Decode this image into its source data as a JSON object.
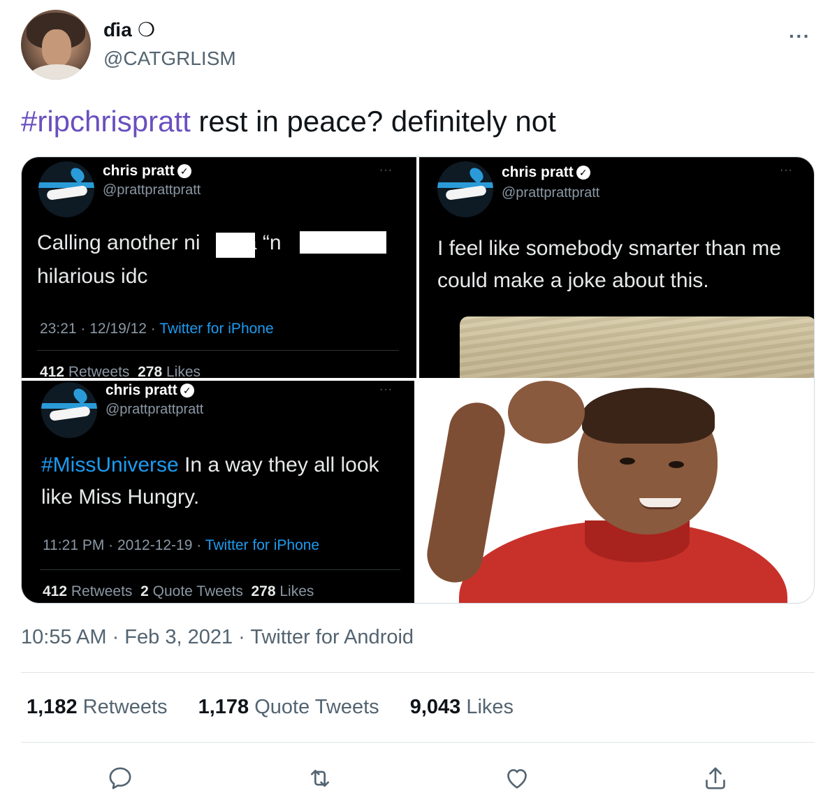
{
  "author": {
    "display_name": "ɗia ❍",
    "handle": "@CATGRLISM",
    "more": "···"
  },
  "tweet": {
    "hashtag": "#ripchrispratt",
    "text": " rest in peace? definitely not"
  },
  "media": {
    "card1": {
      "name": "chris pratt",
      "handle": "@prattprattpratt",
      "dots": "···",
      "line1a": "Calling another ni",
      "line1b": " a “n",
      "line2": "hilarious idc",
      "meta_prefix": "23:21 · 12/19/12 · ",
      "meta_source": "Twitter for iPhone",
      "retweets": "412",
      "retweets_label": " Retweets",
      "likes": "278",
      "likes_label": " Likes"
    },
    "card2": {
      "name": "chris pratt",
      "handle": "@prattprattpratt",
      "dots": "···",
      "line1": "I feel like somebody smarter than me",
      "line2": "could make a joke about this."
    },
    "card3": {
      "name": "chris pratt",
      "handle": "@prattprattpratt",
      "dots": "···",
      "hashtag": "#MissUniverse",
      "line1": " In a way they all look",
      "line2": "like Miss Hungry.",
      "meta_prefix": "11:21 PM · 2012-12-19 · ",
      "meta_source": "Twitter for iPhone",
      "retweets": "412",
      "retweets_label": " Retweets ",
      "quotes": "2",
      "quotes_label": " Quote Tweets ",
      "likes": "278",
      "likes_label": " Likes"
    }
  },
  "meta": {
    "time": "10:55 AM · Feb 3, 2021 · Twitter for Android"
  },
  "stats": {
    "retweets": "1,182",
    "retweets_label": " Retweets",
    "quotes": "1,178",
    "quotes_label": " Quote Tweets",
    "likes": "9,043",
    "likes_label": " Likes"
  },
  "actions": [
    "reply-icon",
    "retweet-icon",
    "like-icon",
    "share-icon"
  ],
  "colors": {
    "hashtag": "#6a4fbf",
    "link_blue": "#1d9bf0",
    "secondary": "#536471"
  }
}
